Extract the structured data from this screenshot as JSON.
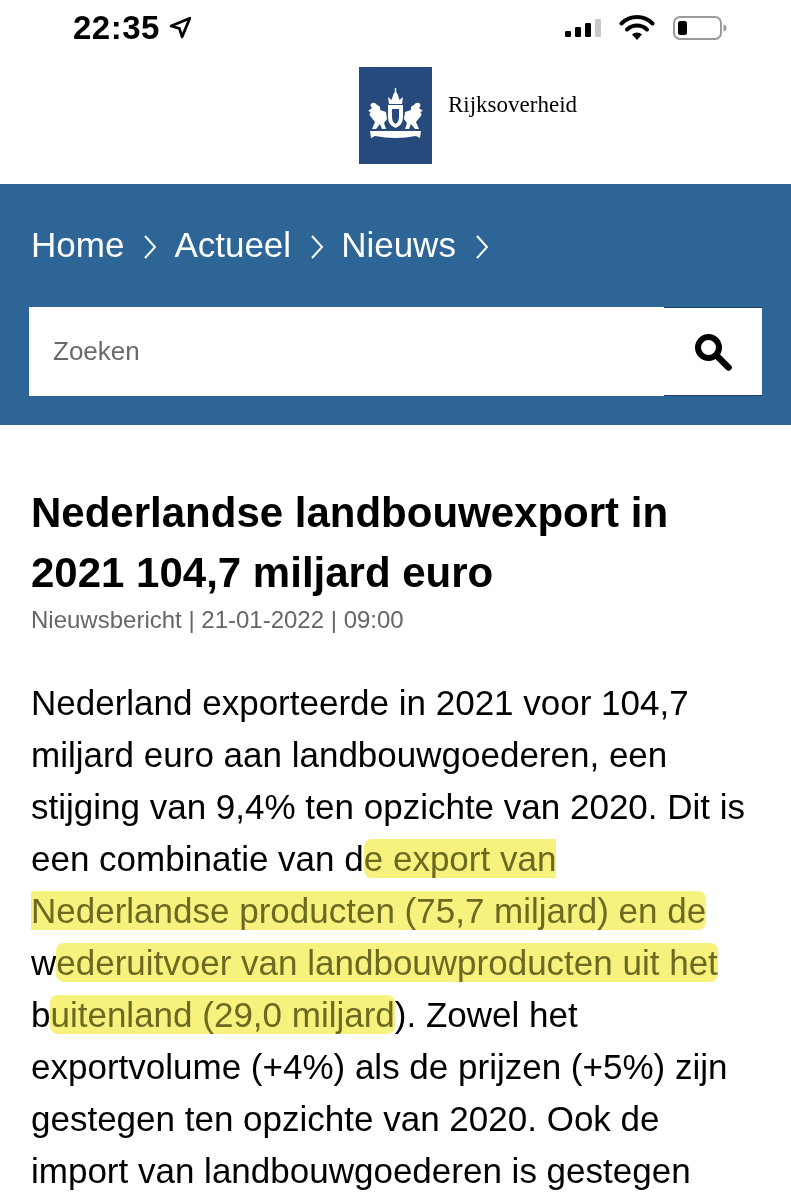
{
  "status_bar": {
    "time": "22:35"
  },
  "header": {
    "logo_text": "Rijksoverheid"
  },
  "breadcrumb": [
    {
      "label": "Home"
    },
    {
      "label": "Actueel"
    },
    {
      "label": "Nieuws"
    }
  ],
  "search": {
    "placeholder": "Zoeken"
  },
  "article": {
    "title": "Nederlandse landbouwexport in 2021 104,7 miljard euro",
    "meta": "Nieuwsbericht | 21-01-2022 | 09:00",
    "body": [
      {
        "text": "Nederland exporteerde in 2021 voor 104,7 miljard euro aan landbouwgoederen, een stijging van 9,4% ten opzichte van 2020. Dit is een combinatie van d",
        "highlighted": false
      },
      {
        "text": "e export van Nederlandse producten (75,7 miljard) en de",
        "highlighted": true
      },
      {
        "text": " w",
        "highlighted": false
      },
      {
        "text": "ederuitvoer van landbouwproducten uit het",
        "highlighted": true
      },
      {
        "text": " b",
        "highlighted": false
      },
      {
        "text": "uitenland (29,0 miljard",
        "highlighted": true
      },
      {
        "text": "). Zowel het exportvolume (+4%) als de prijzen (+5%) zijn gestegen ten opzichte van 2020. Ook de import van landbouwgoederen is gestegen",
        "highlighted": false
      }
    ]
  }
}
